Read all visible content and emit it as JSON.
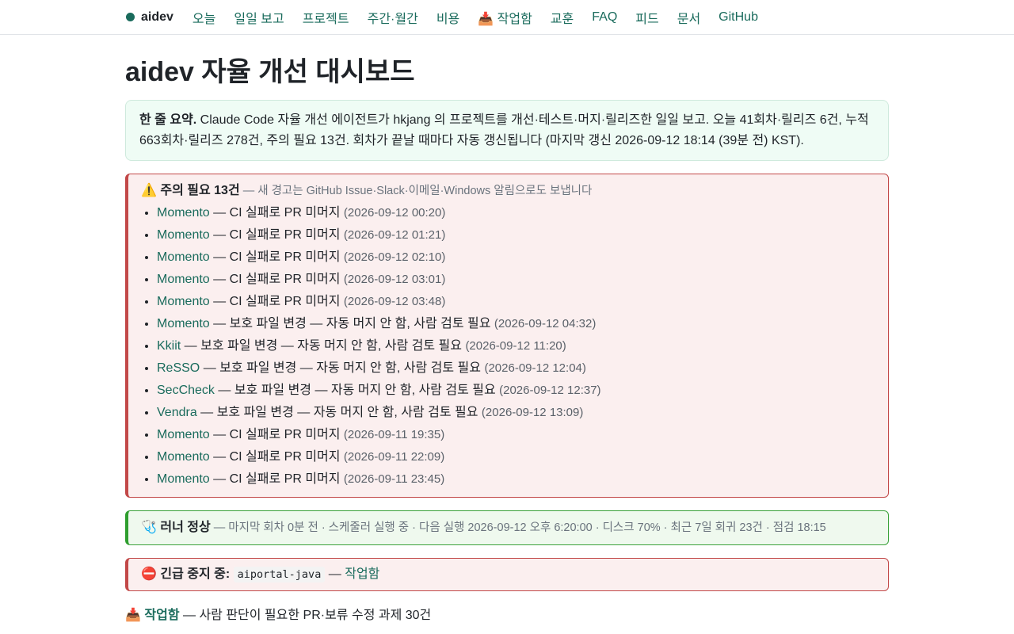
{
  "nav": {
    "brand": "aidev",
    "links": [
      "오늘",
      "일일 보고",
      "프로젝트",
      "주간·월간",
      "비용",
      "📥 작업함",
      "교훈",
      "FAQ",
      "피드",
      "문서",
      "GitHub"
    ]
  },
  "page": {
    "title": "aidev 자율 개선 대시보드"
  },
  "summary": {
    "label": "한 줄 요약.",
    "text": " Claude Code 자율 개선 에이전트가 hkjang 의 프로젝트를 개선·테스트·머지·릴리즈한 일일 보고. 오늘 41회차·릴리즈 6건, 누적 663회차·릴리즈 278건, 주의 필요 13건. 회차가 끝날 때마다 자동 갱신됩니다 (마지막 갱신 2026-09-12 18:14 (39분 전) KST)."
  },
  "alerts": {
    "icon": "⚠️",
    "title": "주의 필요 13건",
    "note": " — 새 경고는 GitHub Issue·Slack·이메일·Windows 알림으로도 보냅니다",
    "items": [
      {
        "project": "Momento",
        "msg": " — CI 실패로 PR 미머지 ",
        "time": "(2026-09-12 00:20)"
      },
      {
        "project": "Momento",
        "msg": " — CI 실패로 PR 미머지 ",
        "time": "(2026-09-12 01:21)"
      },
      {
        "project": "Momento",
        "msg": " — CI 실패로 PR 미머지 ",
        "time": "(2026-09-12 02:10)"
      },
      {
        "project": "Momento",
        "msg": " — CI 실패로 PR 미머지 ",
        "time": "(2026-09-12 03:01)"
      },
      {
        "project": "Momento",
        "msg": " — CI 실패로 PR 미머지 ",
        "time": "(2026-09-12 03:48)"
      },
      {
        "project": "Momento",
        "msg": " — 보호 파일 변경 — 자동 머지 안 함, 사람 검토 필요 ",
        "time": "(2026-09-12 04:32)"
      },
      {
        "project": "Kkiit",
        "msg": " — 보호 파일 변경 — 자동 머지 안 함, 사람 검토 필요 ",
        "time": "(2026-09-12 11:20)"
      },
      {
        "project": "ReSSO",
        "msg": " — 보호 파일 변경 — 자동 머지 안 함, 사람 검토 필요 ",
        "time": "(2026-09-12 12:04)"
      },
      {
        "project": "SecCheck",
        "msg": " — 보호 파일 변경 — 자동 머지 안 함, 사람 검토 필요 ",
        "time": "(2026-09-12 12:37)"
      },
      {
        "project": "Vendra",
        "msg": " — 보호 파일 변경 — 자동 머지 안 함, 사람 검토 필요 ",
        "time": "(2026-09-12 13:09)"
      },
      {
        "project": "Momento",
        "msg": " — CI 실패로 PR 미머지 ",
        "time": "(2026-09-11 19:35)"
      },
      {
        "project": "Momento",
        "msg": " — CI 실패로 PR 미머지 ",
        "time": "(2026-09-11 22:09)"
      },
      {
        "project": "Momento",
        "msg": " — CI 실패로 PR 미머지 ",
        "time": "(2026-09-11 23:45)"
      }
    ]
  },
  "runner": {
    "icon": "🩺",
    "title": "러너 정상",
    "detail": " — 마지막 회차 0분 전 · 스케줄러 실행 중 · 다음 실행 2026-09-12 오후 6:20:00 · 디스크 70% · 최근 7일 회귀 23건 · 점검 18:15"
  },
  "stop": {
    "icon": "⛔",
    "label": "긴급 중지 중:",
    "project": "aiportal-java",
    "sep": " — ",
    "link": "작업함"
  },
  "inbox": {
    "icon": "📥",
    "label": "작업함",
    "text": " — 사람 판단이 필요한 PR·보류 수정 과제 30건"
  },
  "colors": {
    "accent": "#1a6b5c",
    "danger": "#c24848",
    "ok": "#2f9e2f"
  }
}
